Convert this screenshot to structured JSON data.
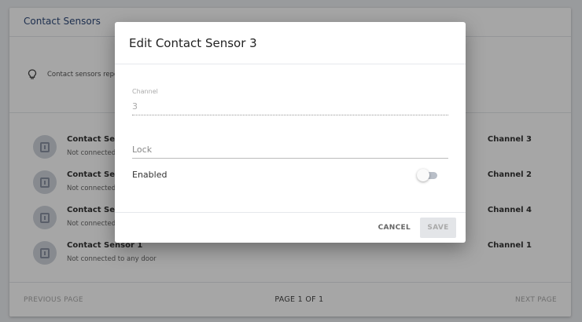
{
  "card": {
    "title": "Contact Sensors",
    "info_text": "Contact sensors repo"
  },
  "sensors": [
    {
      "title": "Contact Sens",
      "subtitle": "Not connected",
      "channel": "Channel 3"
    },
    {
      "title": "Contact Sens",
      "subtitle": "Not connected",
      "channel": "Channel 2"
    },
    {
      "title": "Contact Sens",
      "subtitle": "Not connected",
      "channel": "Channel 4"
    },
    {
      "title": "Contact Sensor 1",
      "subtitle": "Not connected to any door",
      "channel": "Channel 1"
    }
  ],
  "footer": {
    "previous": "PREVIOUS PAGE",
    "page": "PAGE 1 OF 1",
    "next": "NEXT PAGE"
  },
  "dialog": {
    "title": "Edit Contact Sensor 3",
    "channel_label": "Channel",
    "channel_value": "3",
    "lock_placeholder": "Lock",
    "enabled_label": "Enabled",
    "enabled": false,
    "cancel_label": "CANCEL",
    "save_label": "SAVE"
  },
  "colors": {
    "header_title": "#2f4a7a",
    "overlay": "rgba(0,0,0,0.35)"
  },
  "icons": {
    "info": "lightbulb-icon",
    "sensor": "door-sensor-icon"
  }
}
